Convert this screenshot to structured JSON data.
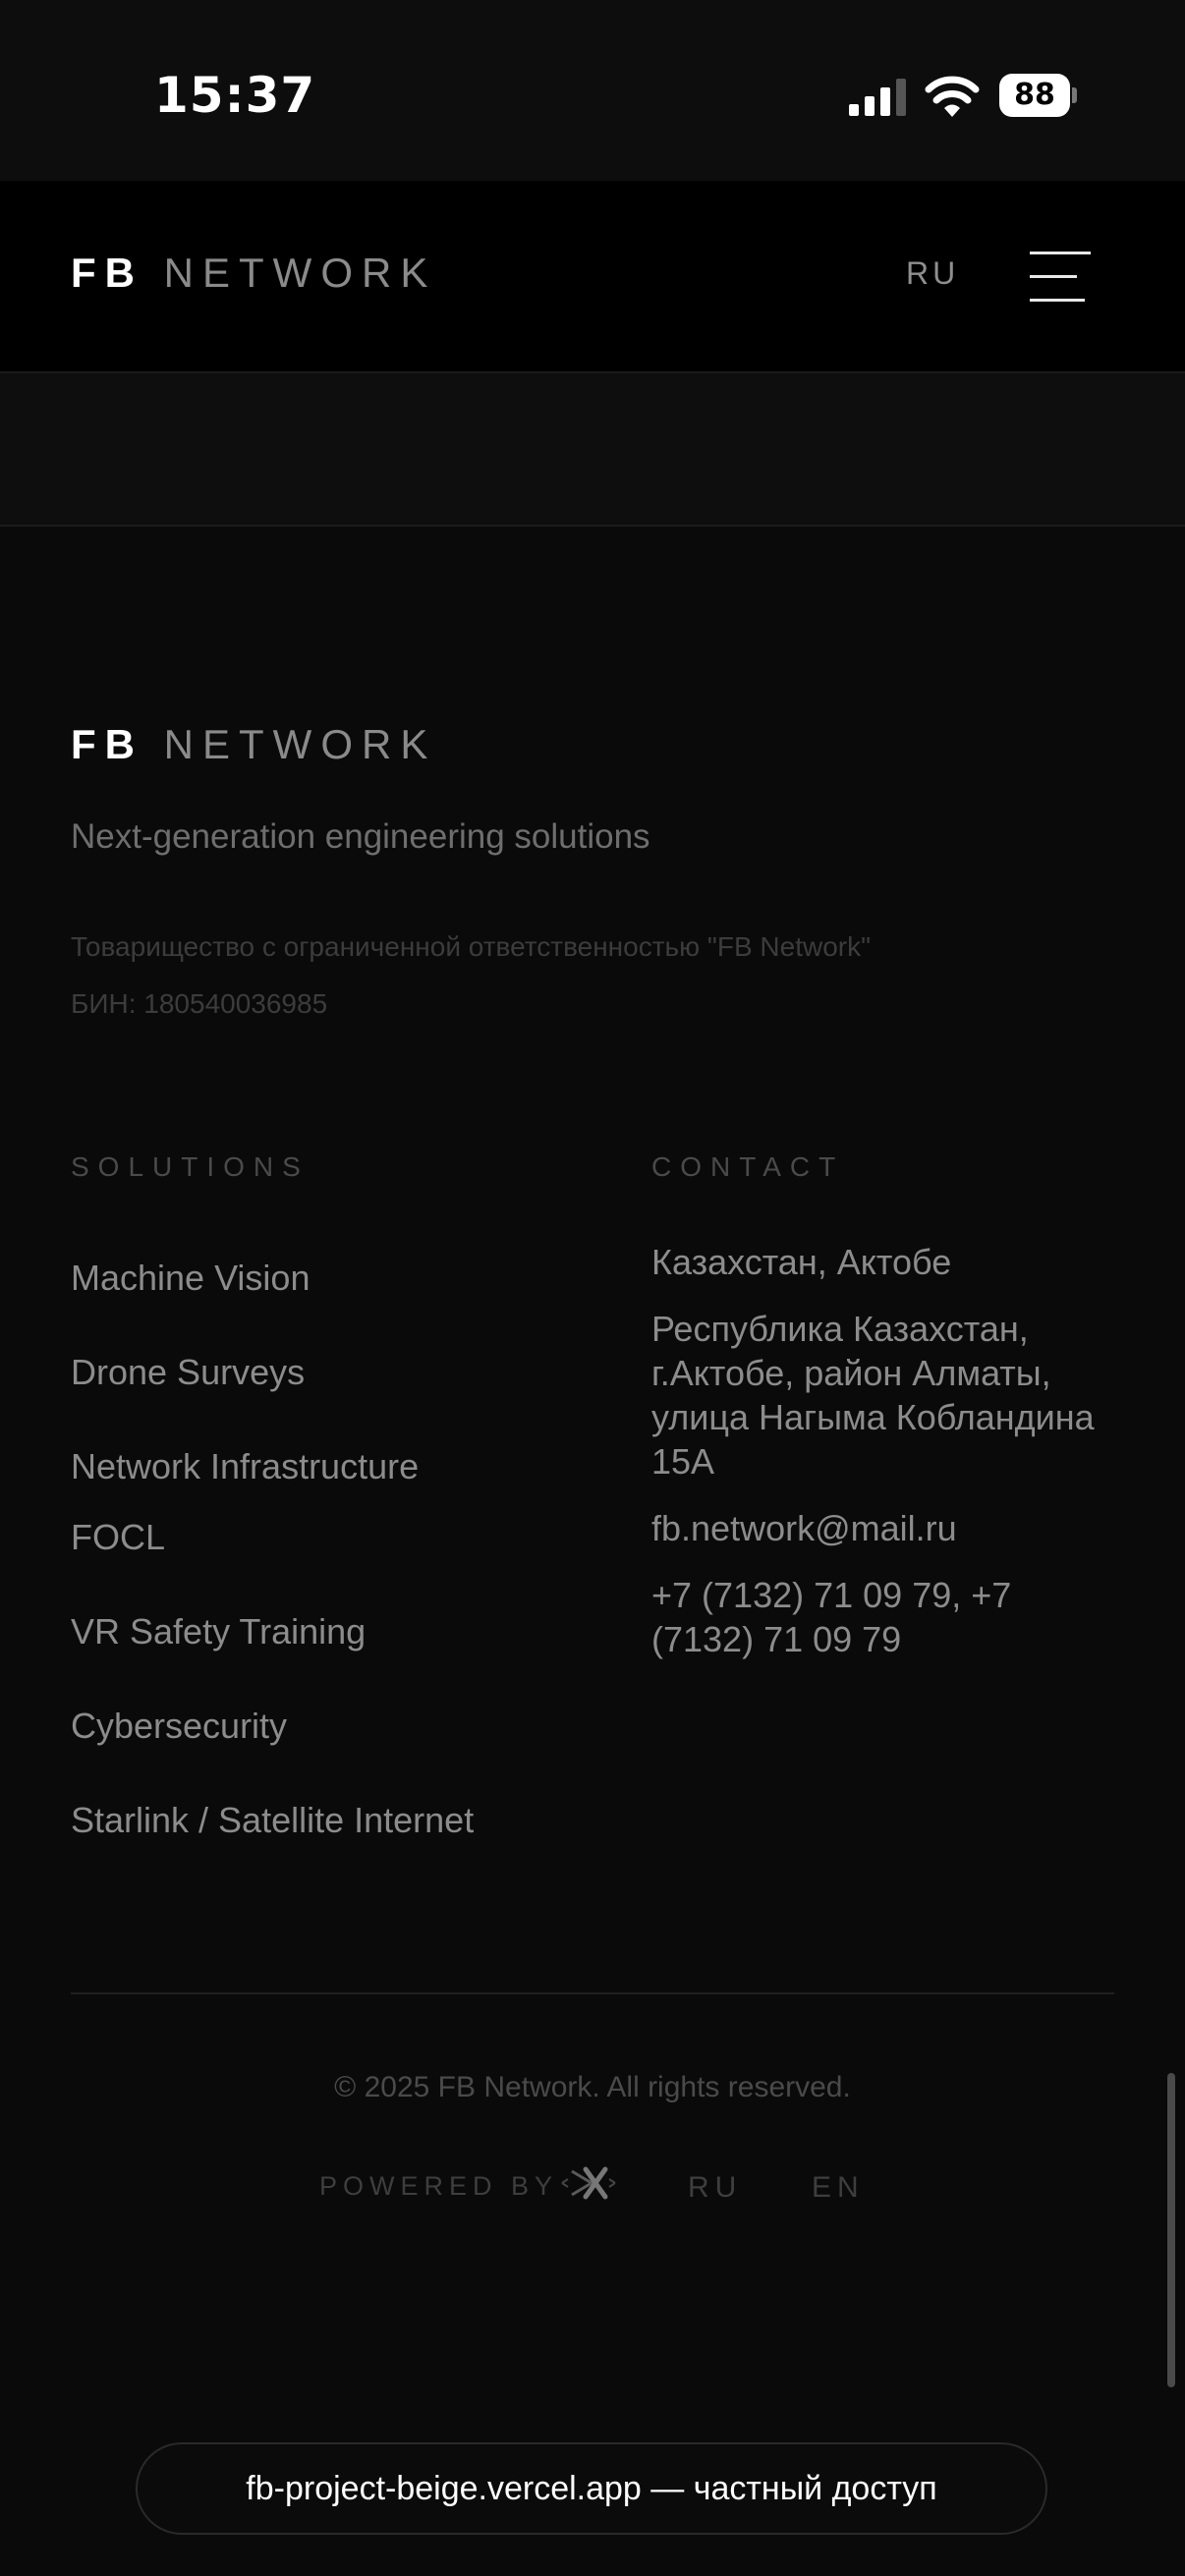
{
  "status_bar": {
    "time": "15:37",
    "battery": "88",
    "icons": [
      "signal-icon",
      "wifi-icon",
      "battery-icon"
    ]
  },
  "header": {
    "logo_bold": "FB",
    "logo_light": "NETWORK",
    "language": "RU",
    "menu_icon": "hamburger-menu-icon"
  },
  "footer": {
    "logo_bold": "FB",
    "logo_light": "NETWORK",
    "tagline": "Next-generation engineering solutions",
    "company_name": "Товарищество с ограниченной ответственностью \"FB Network\"",
    "bin": "БИН: 180540036985",
    "solutions": {
      "title": "SOLUTIONS",
      "items": [
        "Machine Vision",
        "Drone Surveys",
        "Network Infrastructure",
        "FOCL",
        "VR Safety Training",
        "Cybersecurity",
        "Starlink / Satellite Internet"
      ]
    },
    "contact": {
      "title": "CONTACT",
      "city": "Казахстан, Актобе",
      "address": "Республика Казахстан, г.Актобе, район Алматы, улица Нагыма Кобландина 15А",
      "email": "fb.network@mail.ru",
      "phone": "+7 (7132) 71 09 79, +7 (7132) 71 09 79"
    },
    "copyright": "© 2025 FB Network. All rights reserved.",
    "powered_by": "POWERED BY",
    "languages": [
      "RU",
      "EN"
    ]
  },
  "browser": {
    "url_text": "fb-project-beige.vercel.app — частный доступ"
  },
  "colors": {
    "background": "#0a0a0a",
    "header_bg": "#000000",
    "text_primary": "#ffffff",
    "text_muted": "#8c8c8c",
    "text_dim": "#4a4a4a"
  }
}
